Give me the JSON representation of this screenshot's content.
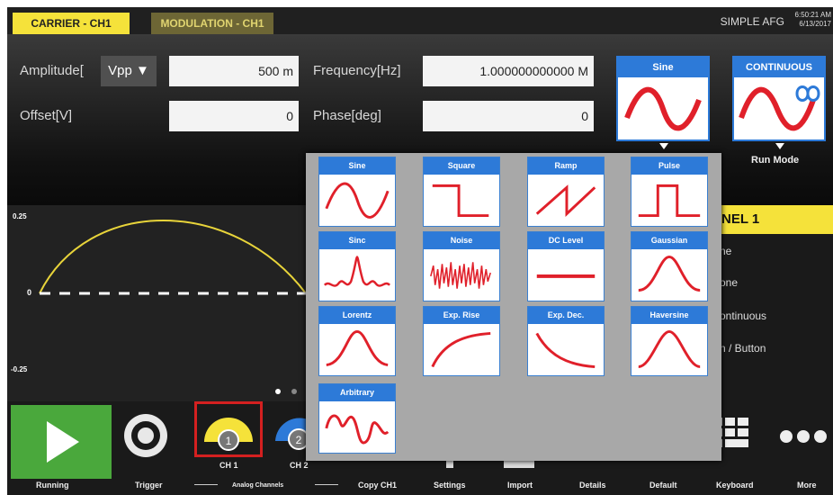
{
  "tabs": [
    {
      "label": "CARRIER - CH1"
    },
    {
      "label": "MODULATION - CH1"
    }
  ],
  "app_name": "SIMPLE AFG",
  "clock": {
    "time": "6:50:21 AM",
    "date": "6/13/2017"
  },
  "params": {
    "amplitude_label": "Amplitude[",
    "amplitude_unit": "Vpp ▼",
    "amplitude_value": "500 m",
    "frequency_label": "Frequency[Hz]",
    "frequency_value": "1.000000000000 M",
    "offset_label": "Offset[V]",
    "offset_value": "0",
    "phase_label": "Phase[deg]",
    "phase_value": "0"
  },
  "waveform_button": {
    "label": "Sine"
  },
  "run_mode_button": {
    "label": "CONTINUOUS",
    "caption": "Run Mode"
  },
  "graph": {
    "y_top": "0.25",
    "y_zero": "0",
    "y_bottom": "-0.25"
  },
  "channel_panel": {
    "title": "NEL 1",
    "rows": [
      "ne",
      "one",
      "ontinuous",
      "n / Button"
    ]
  },
  "waveform_menu": [
    {
      "label": "Sine",
      "icon": "sine-wave-icon"
    },
    {
      "label": "Square",
      "icon": "square-wave-icon"
    },
    {
      "label": "Ramp",
      "icon": "ramp-wave-icon"
    },
    {
      "label": "Pulse",
      "icon": "pulse-wave-icon"
    },
    {
      "label": "Sinc",
      "icon": "sinc-wave-icon"
    },
    {
      "label": "Noise",
      "icon": "noise-wave-icon"
    },
    {
      "label": "DC Level",
      "icon": "dc-level-icon"
    },
    {
      "label": "Gaussian",
      "icon": "gaussian-wave-icon"
    },
    {
      "label": "Lorentz",
      "icon": "lorentz-wave-icon"
    },
    {
      "label": "Exp. Rise",
      "icon": "exp-rise-icon"
    },
    {
      "label": "Exp. Dec.",
      "icon": "exp-decay-icon"
    },
    {
      "label": "Haversine",
      "icon": "haversine-icon"
    },
    {
      "label": "Arbitrary",
      "icon": "arbitrary-wave-icon"
    }
  ],
  "bottom": {
    "ch1": "CH 1",
    "ch2": "CH 2",
    "ch1_num": "1",
    "ch2_num": "2",
    "labels": {
      "running": "Running",
      "trigger": "Trigger",
      "analog": "Analog Channels",
      "copy": "Copy CH1",
      "settings": "Settings",
      "import": "Import",
      "details": "Details",
      "default": "Default",
      "keyboard": "Keyboard",
      "more": "More"
    }
  },
  "colors": {
    "accent_yellow": "#f5e23a",
    "accent_blue": "#2d7ad8",
    "wave_red": "#e0202a",
    "run_green": "#4aa83c"
  }
}
